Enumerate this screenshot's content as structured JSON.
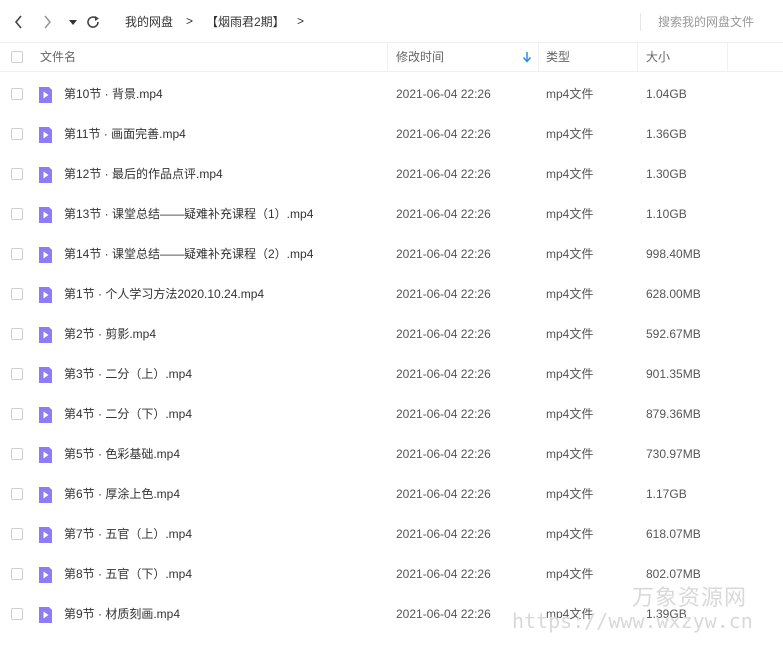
{
  "toolbar": {
    "back_icon": "chevron-left-icon",
    "forward_icon": "chevron-right-icon",
    "history_icon": "caret-down-icon",
    "refresh_icon": "refresh-icon",
    "breadcrumb": [
      "我的网盘",
      "【烟雨君2期】"
    ],
    "search_placeholder": "搜索我的网盘文件"
  },
  "table": {
    "headers": {
      "name": "文件名",
      "modified": "修改时间",
      "type": "类型",
      "size": "大小"
    },
    "sort_icon": "sort-down-arrow-icon",
    "accent_color": "#2e8ae6",
    "file_icon_color": "#8e7cf6",
    "rows": [
      {
        "name": "第10节 · 背景.mp4",
        "modified": "2021-06-04 22:26",
        "type": "mp4文件",
        "size": "1.04GB"
      },
      {
        "name": "第11节 · 画面完善.mp4",
        "modified": "2021-06-04 22:26",
        "type": "mp4文件",
        "size": "1.36GB"
      },
      {
        "name": "第12节 · 最后的作品点评.mp4",
        "modified": "2021-06-04 22:26",
        "type": "mp4文件",
        "size": "1.30GB"
      },
      {
        "name": "第13节 · 课堂总结——疑难补充课程（1）.mp4",
        "modified": "2021-06-04 22:26",
        "type": "mp4文件",
        "size": "1.10GB"
      },
      {
        "name": "第14节 · 课堂总结——疑难补充课程（2）.mp4",
        "modified": "2021-06-04 22:26",
        "type": "mp4文件",
        "size": "998.40MB"
      },
      {
        "name": "第1节 · 个人学习方法2020.10.24.mp4",
        "modified": "2021-06-04 22:26",
        "type": "mp4文件",
        "size": "628.00MB"
      },
      {
        "name": "第2节 · 剪影.mp4",
        "modified": "2021-06-04 22:26",
        "type": "mp4文件",
        "size": "592.67MB"
      },
      {
        "name": "第3节 · 二分（上）.mp4",
        "modified": "2021-06-04 22:26",
        "type": "mp4文件",
        "size": "901.35MB"
      },
      {
        "name": "第4节 · 二分（下）.mp4",
        "modified": "2021-06-04 22:26",
        "type": "mp4文件",
        "size": "879.36MB"
      },
      {
        "name": "第5节 · 色彩基础.mp4",
        "modified": "2021-06-04 22:26",
        "type": "mp4文件",
        "size": "730.97MB"
      },
      {
        "name": "第6节 · 厚涂上色.mp4",
        "modified": "2021-06-04 22:26",
        "type": "mp4文件",
        "size": "1.17GB"
      },
      {
        "name": "第7节 · 五官（上）.mp4",
        "modified": "2021-06-04 22:26",
        "type": "mp4文件",
        "size": "618.07MB"
      },
      {
        "name": "第8节 · 五官（下）.mp4",
        "modified": "2021-06-04 22:26",
        "type": "mp4文件",
        "size": "802.07MB"
      },
      {
        "name": "第9节 · 材质刻画.mp4",
        "modified": "2021-06-04 22:26",
        "type": "mp4文件",
        "size": "1.39GB"
      }
    ]
  },
  "watermark": {
    "text": "万象资源网",
    "url": "https://www.wxzyw.cn"
  }
}
